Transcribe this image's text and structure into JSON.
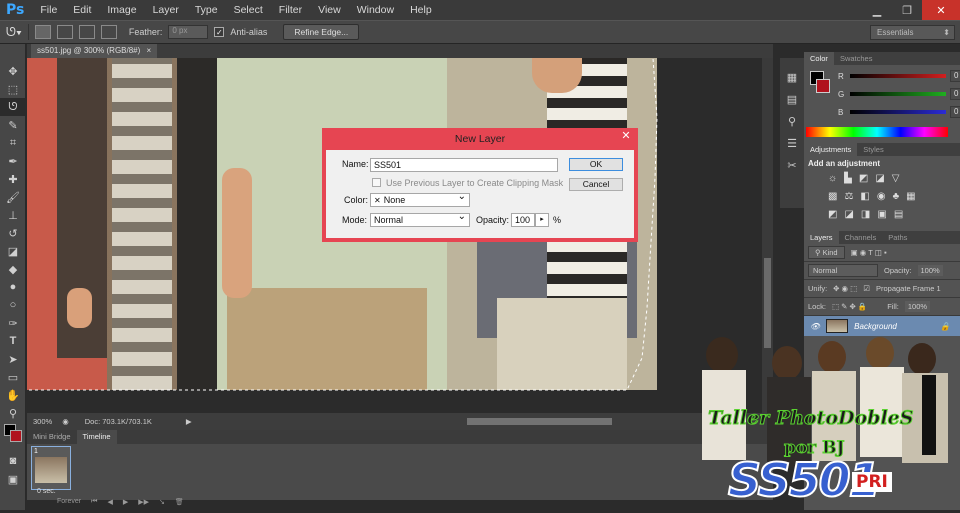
{
  "app": {
    "logo": "Ps"
  },
  "menu": [
    "File",
    "Edit",
    "Image",
    "Layer",
    "Type",
    "Select",
    "Filter",
    "View",
    "Window",
    "Help"
  ],
  "options": {
    "feather_label": "Feather:",
    "feather_value": "0 px",
    "antialias_label": "Anti-alias",
    "refine_edge": "Refine Edge...",
    "workspace": "Essentials"
  },
  "document": {
    "tab_title": "ss501.jpg @ 300% (RGB/8#)",
    "zoom": "300%",
    "doc_size": "Doc: 703.1K/703.1K"
  },
  "bottom_panel": {
    "tabs": [
      "Mini Bridge",
      "Timeline"
    ],
    "frame_number": "1",
    "frame_time": "0 sec.",
    "loop": "Forever"
  },
  "color_panel": {
    "tabs": [
      "Color",
      "Swatches"
    ],
    "channels": [
      {
        "label": "R",
        "value": "0",
        "color": "#d21f1f"
      },
      {
        "label": "G",
        "value": "0",
        "color": "#1fae1f"
      },
      {
        "label": "B",
        "value": "0",
        "color": "#2b2bd6"
      }
    ]
  },
  "adjustments_panel": {
    "tabs": [
      "Adjustments",
      "Styles"
    ],
    "title": "Add an adjustment"
  },
  "layers_panel": {
    "tabs": [
      "Layers",
      "Channels",
      "Paths"
    ],
    "kind": "Kind",
    "blend_mode": "Normal",
    "opacity_label": "Opacity:",
    "opacity_value": "100%",
    "unify_label": "Unify:",
    "propagate": "Propagate Frame 1",
    "lock_label": "Lock:",
    "fill_label": "Fill:",
    "fill_value": "100%",
    "layers": [
      {
        "name": "Background"
      }
    ]
  },
  "dialog": {
    "title": "New Layer",
    "name_label": "Name:",
    "name_value": "SS501",
    "clipping_label": "Use Previous Layer to Create Clipping Mask",
    "color_label": "Color:",
    "color_value": "None",
    "mode_label": "Mode:",
    "mode_value": "Normal",
    "opacity_label": "Opacity:",
    "opacity_value": "100",
    "opacity_unit": "%",
    "ok": "OK",
    "cancel": "Cancel"
  },
  "promo": {
    "line1": "Taller PhotoDobleS",
    "line2": "por BJ",
    "brand": "SS501",
    "badge": "PRI"
  }
}
